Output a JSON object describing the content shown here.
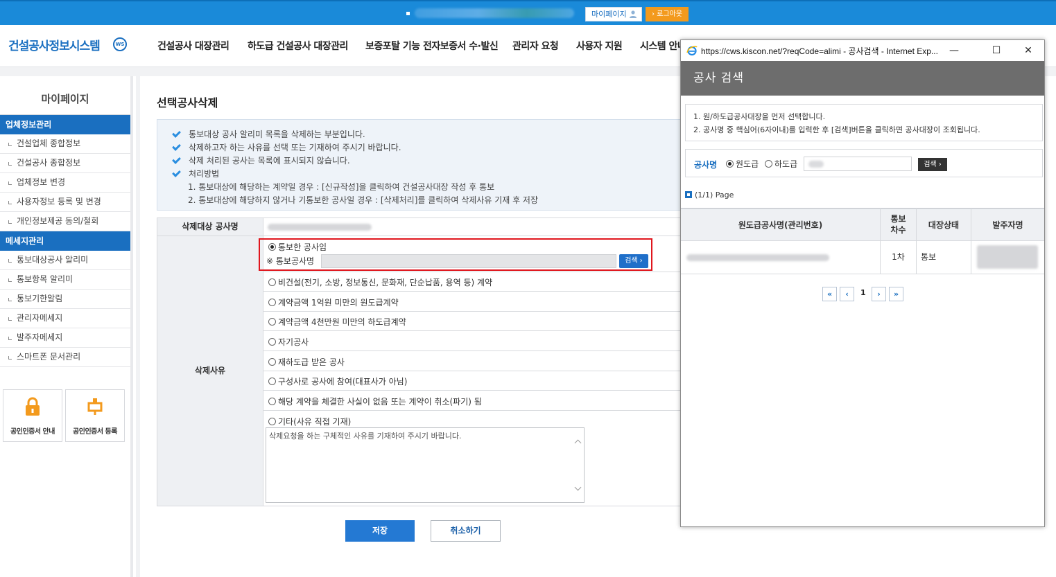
{
  "topbar": {
    "mypage_label": "마이페이지",
    "logout_label": "로그아웃"
  },
  "header": {
    "logo": "건설공사정보시스템",
    "logo_badge": "WS",
    "nav": [
      "건설공사 대장관리",
      "하도급 건설공사 대장관리",
      "보증포탈 기능 전자보증서 수·발신",
      "관리자 요청",
      "사용자 지원",
      "시스템 안내"
    ]
  },
  "sidebar": {
    "title": "마이페이지",
    "sections": [
      {
        "title": "업체정보관리",
        "items": [
          "건설업체 종합정보",
          "건설공사 종합정보",
          "업체정보 변경",
          "사용자정보 등록 및 변경",
          "개인정보제공 동의/철회"
        ]
      },
      {
        "title": "메세지관리",
        "items": [
          "통보대상공사 알리미",
          "통보항목 알리미",
          "통보기한알림",
          "관리자메세지",
          "발주자메세지",
          "스마트폰 문서관리"
        ]
      }
    ],
    "cert_guide": "공인인증서 안내",
    "cert_register": "공인인증서 등록"
  },
  "main": {
    "title": "선택공사삭제",
    "info": [
      "통보대상 공사 알리미 목록을 삭제하는 부분입니다.",
      "삭제하고자 하는 사유를 선택 또는 기재하여 주시기 바랍니다.",
      "삭제 처리된 공사는 목록에 표시되지 않습니다.",
      "처리방법"
    ],
    "info_steps": [
      "1. 통보대상에 해당하는 계약일 경우 : [신규작성]을 클릭하여 건설공사대장 작성 후 통보",
      "2. 통보대상에 해당하지 않거나 기통보한 공사일 경우 : [삭제처리]를 클릭하여 삭제사유 기재 후 저장"
    ],
    "label_target": "삭제대상 공사명",
    "label_reason": "삭제사유",
    "reasons": [
      "통보한 공사임",
      "비건설(전기, 소방, 정보통신, 문화재, 단순납품, 용역 등) 계약",
      "계약금액 1억원 미만의 원도급계약",
      "계약금액 4천만원 미만의 하도급계약",
      "자기공사",
      "재하도급 받은 공사",
      "구성사로 공사에 참여(대표사가 아님)",
      "해당 계약을 체결한 사실이 없음 또는 계약이 취소(파기) 됨",
      "기타(사유 직접 기재)"
    ],
    "notified_label": "※ 통보공사명",
    "search_btn": "검색",
    "textarea_placeholder": "삭제요청을 하는 구체적인 사유를 기재하여 주시기 바랍니다.",
    "save_btn": "저장",
    "cancel_btn": "취소하기"
  },
  "popup": {
    "url": "https://cws.kiscon.net/?reqCode=alimi - 공사검색 - Internet Exp...",
    "title": "공사 검색",
    "notes": [
      "1. 원/하도급공사대장을 먼저 선택합니다.",
      "2. 공사명 중 핵심어(6자이내)를 입력한 후 [검색]버튼을 클릭하면 공사대장이 조회됩니다."
    ],
    "search_label": "공사명",
    "radio_prime": "원도급",
    "radio_sub": "하도급",
    "search_btn": "검색",
    "page_info": "(1/1) Page",
    "columns": [
      "원도급공사명(관리번호)",
      "통보\n차수",
      "대장상태",
      "발주자명"
    ],
    "row": {
      "count": "1차",
      "status": "통보"
    },
    "current_page": "1"
  },
  "colors": {
    "brand": "#1a6fc0",
    "topbar": "#1a8ad9",
    "logout": "#f39a1d",
    "highlight": "#e0161d"
  }
}
